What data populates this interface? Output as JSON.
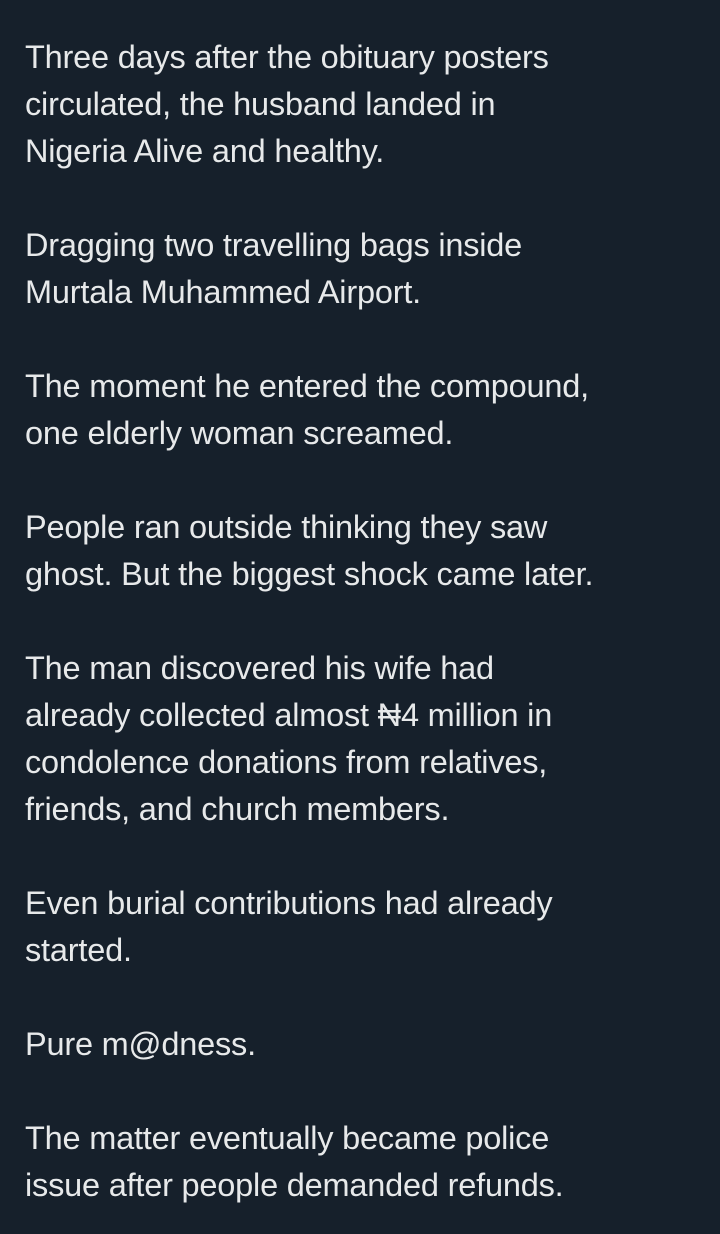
{
  "post": {
    "paragraphs": [
      {
        "lines": [
          "Three days after the obituary posters",
          "circulated, the husband landed in",
          "Nigeria Alive and healthy."
        ]
      },
      {
        "lines": [
          "Dragging two travelling bags inside",
          "Murtala Muhammed Airport."
        ]
      },
      {
        "lines": [
          "The moment he entered the compound,",
          "one elderly woman screamed."
        ]
      },
      {
        "lines": [
          "People ran outside thinking they saw",
          "ghost. But the biggest shock came later."
        ]
      },
      {
        "lines": [
          "The man discovered his wife had",
          "already collected almost ₦4 million in",
          "condolence donations from relatives,",
          "friends, and church members."
        ]
      },
      {
        "lines": [
          "Even burial contributions had already",
          "started."
        ]
      },
      {
        "lines": [
          "Pure m@dness."
        ]
      },
      {
        "lines": [
          "The matter eventually became police",
          "issue after people demanded refunds."
        ]
      }
    ]
  }
}
